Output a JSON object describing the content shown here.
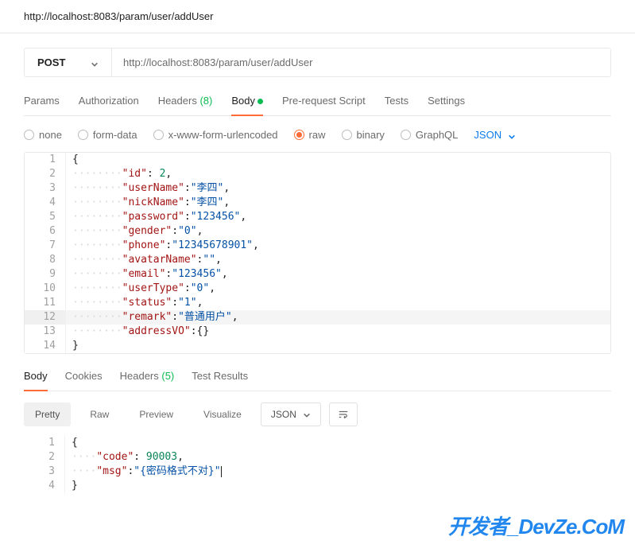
{
  "header": {
    "url_label": "http://localhost:8083/param/user/addUser"
  },
  "request": {
    "method": "POST",
    "url": "http://localhost:8083/param/user/addUser"
  },
  "tabs": {
    "params": "Params",
    "auth": "Authorization",
    "headers": "Headers",
    "headers_count": "(8)",
    "body": "Body",
    "prereq": "Pre-request Script",
    "tests": "Tests",
    "settings": "Settings"
  },
  "body_types": {
    "none": "none",
    "form_data": "form-data",
    "urlencoded": "x-www-form-urlencoded",
    "raw": "raw",
    "binary": "binary",
    "graphql": "GraphQL",
    "format": "JSON"
  },
  "body_lines": [
    {
      "n": 1,
      "indent": 0,
      "kind": "punc",
      "text": "{"
    },
    {
      "n": 2,
      "indent": 2,
      "kind": "kv_num",
      "key": "id",
      "value": "2",
      "comma": true
    },
    {
      "n": 3,
      "indent": 2,
      "kind": "kv_str",
      "key": "userName",
      "value": "李四",
      "comma": true
    },
    {
      "n": 4,
      "indent": 2,
      "kind": "kv_str",
      "key": "nickName",
      "value": "李四",
      "comma": true
    },
    {
      "n": 5,
      "indent": 2,
      "kind": "kv_str",
      "key": "password",
      "value": "123456",
      "comma": true
    },
    {
      "n": 6,
      "indent": 2,
      "kind": "kv_str",
      "key": "gender",
      "value": "0",
      "comma": true
    },
    {
      "n": 7,
      "indent": 2,
      "kind": "kv_str",
      "key": "phone",
      "value": "12345678901",
      "comma": true
    },
    {
      "n": 8,
      "indent": 2,
      "kind": "kv_str",
      "key": "avatarName",
      "value": "",
      "comma": true
    },
    {
      "n": 9,
      "indent": 2,
      "kind": "kv_str",
      "key": "email",
      "value": "123456",
      "comma": true
    },
    {
      "n": 10,
      "indent": 2,
      "kind": "kv_str",
      "key": "userType",
      "value": "0",
      "comma": true
    },
    {
      "n": 11,
      "indent": 2,
      "kind": "kv_str",
      "key": "status",
      "value": "1",
      "comma": true
    },
    {
      "n": 12,
      "indent": 2,
      "kind": "kv_str",
      "key": "remark",
      "value": "普通用户",
      "comma": true,
      "highlight": true
    },
    {
      "n": 13,
      "indent": 2,
      "kind": "kv_obj",
      "key": "addressVO",
      "value": "{}",
      "comma": false
    },
    {
      "n": 14,
      "indent": 0,
      "kind": "punc",
      "text": "}"
    }
  ],
  "response": {
    "tabs": {
      "body": "Body",
      "cookies": "Cookies",
      "headers": "Headers",
      "headers_count": "(5)",
      "test_results": "Test Results"
    },
    "toolbar": {
      "pretty": "Pretty",
      "raw": "Raw",
      "preview": "Preview",
      "visualize": "Visualize",
      "format": "JSON"
    },
    "lines": [
      {
        "n": 1,
        "indent": 0,
        "kind": "punc",
        "text": "{"
      },
      {
        "n": 2,
        "indent": 1,
        "kind": "kv_num",
        "key": "code",
        "value": "90003",
        "comma": true
      },
      {
        "n": 3,
        "indent": 1,
        "kind": "kv_str",
        "key": "msg",
        "value": "{密码格式不对}",
        "comma": false,
        "cursor": true
      },
      {
        "n": 4,
        "indent": 0,
        "kind": "punc",
        "text": "}"
      }
    ]
  },
  "watermark": "开发者_DevZe.CoM"
}
